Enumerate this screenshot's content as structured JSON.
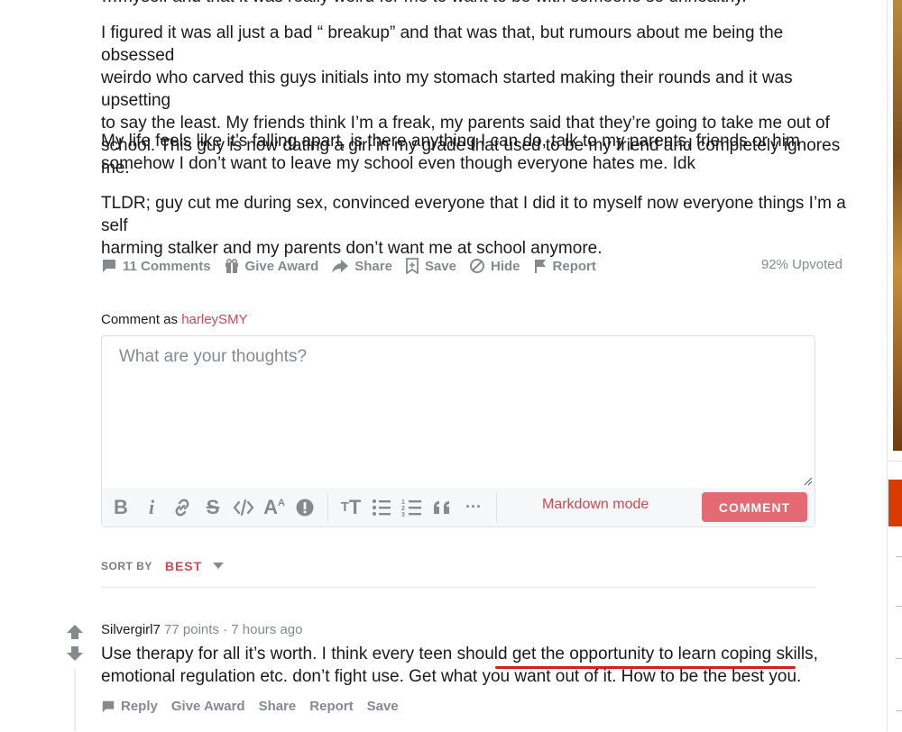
{
  "post": {
    "cropped_line": "…myself and that it was really weird for me to want to be with someone so unhealthy.",
    "paragraphs": [
      [
        "I figured it was all just a bad “ breakup” and that was that, but rumours about me being the obsessed",
        "weirdo who carved this guys initials into my stomach started making their rounds and it was upsetting",
        "to say the least. My friends think I’m a freak, my parents said that they’re going to take me out of",
        "school. This guy is now dating a girl in my grade that used to be my friend and completely ignores me."
      ],
      [
        "My life feels like it’s falling apart, is there anything I can do, talk to my parents, friends or him",
        "somehow I don’t want to leave my school even though everyone hates me. Idk"
      ],
      [
        "TLDR; guy cut me during sex, convinced everyone that I did it to myself now everyone things I’m a self",
        "harming stalker and my parents don’t want me at school anymore."
      ]
    ]
  },
  "actions": {
    "comments": "11 Comments",
    "give_award": "Give Award",
    "share": "Share",
    "save": "Save",
    "hide": "Hide",
    "report": "Report",
    "upvoted": "92% Upvoted"
  },
  "comment_box": {
    "comment_as_label": "Comment as",
    "username": "harleySMY",
    "placeholder": "What are your thoughts?",
    "markdown_mode": "Markdown mode",
    "submit": "COMMENT",
    "toolbar_icons": [
      "bold-icon",
      "italic-icon",
      "link-icon",
      "strikethrough-icon",
      "code-icon",
      "superscript-icon",
      "spoiler-icon",
      "heading-icon",
      "bulleted-list-icon",
      "numbered-list-icon",
      "quote-icon",
      "more-icon"
    ]
  },
  "sort": {
    "label": "SORT BY",
    "value": "BEST"
  },
  "comment": {
    "author": "Silvergirl7",
    "points": "77 points",
    "separator": "·",
    "time": "7 hours ago",
    "body_lines": [
      "Use therapy for all it’s worth. I think every teen should get the opportunity to learn coping skills,",
      "emotional regulation etc. don’t fight use. Get what you want out of it. How to be the best you."
    ],
    "actions": {
      "reply": "Reply",
      "give_award": "Give Award",
      "share": "Share",
      "report": "Report",
      "save": "Save"
    }
  },
  "colors": {
    "accent": "#ce4a55",
    "comment_button": "#e36a72",
    "muted": "#878a8c",
    "underline": "#d3201f"
  }
}
